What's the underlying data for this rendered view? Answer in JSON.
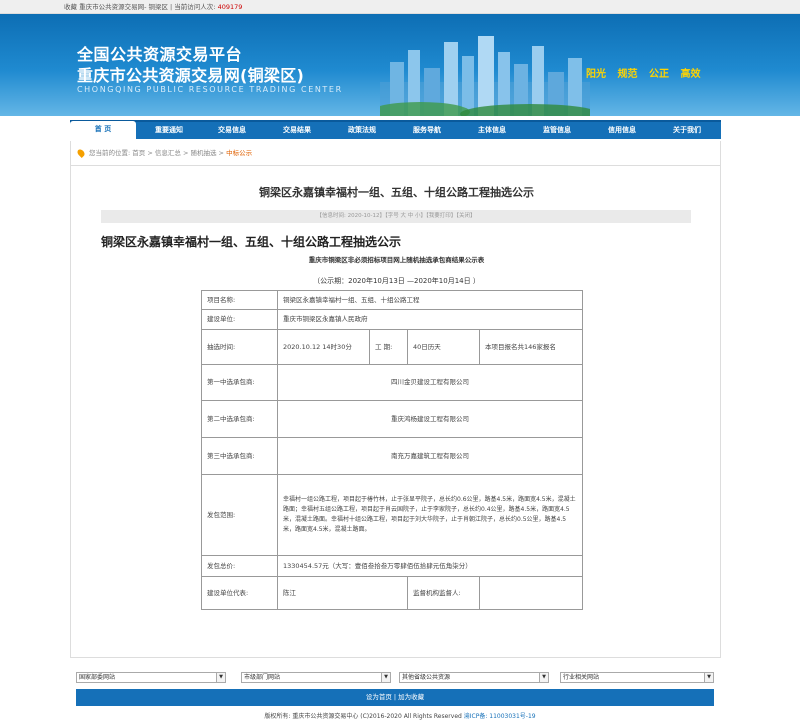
{
  "topbar": {
    "text": "收藏 重庆市公共资源交易网- 铜梁区 | 当前访问人次:",
    "count": "409179"
  },
  "banner": {
    "title1": "全国公共资源交易平台",
    "title2": "重庆市公共资源交易网(铜梁区)",
    "title_en": "CHONGQING PUBLIC RESOURCE TRADING CENTER",
    "slogan": [
      "阳光",
      "规范",
      "公正",
      "高效"
    ]
  },
  "nav": {
    "items": [
      "首 页",
      "重要通知",
      "交易信息",
      "交易结果",
      "政策法规",
      "服务导航",
      "主体信息",
      "监管信息",
      "信用信息",
      "关于我们"
    ]
  },
  "breadcrumb": {
    "prefix": "您当前的位置:",
    "path": [
      "首页",
      "信息汇总",
      "随机抽选"
    ],
    "current": "中标公示"
  },
  "article": {
    "title": "铜梁区永嘉镇幸福村一组、五组、十组公路工程抽选公示",
    "info_bar": "【信息时间: 2020-10-12】【字号 大 中 小】【我要打印】【关闭】",
    "heading": "铜梁区永嘉镇幸福村一组、五组、十组公路工程抽选公示",
    "subheading": "重庆市铜梁区非必须招标项目网上随机抽选承包商结果公示表",
    "period": "（公示期：2020年10月13日 —2020年10月14日 ）"
  },
  "table": {
    "project_name_label": "项目名称:",
    "project_name": "铜梁区永嘉镇幸福村一组、五组、十组公路工程",
    "builder_label": "建设单位:",
    "builder": "重庆市铜梁区永嘉镇人民政府",
    "select_time_label": "抽选时间:",
    "select_time": "2020.10.12 14时30分",
    "period_label": "工 期:",
    "period": "40日历天",
    "note": "本项目报名共146家报名",
    "first_label": "第一中选承包商:",
    "first": "四川金贝建设工程有限公司",
    "second_label": "第二中选承包商:",
    "second": "重庆鸿杨建设工程有限公司",
    "third_label": "第三中选承包商:",
    "third": "南充万嘉建筑工程有限公司",
    "scope_label": "发包范围:",
    "scope": "幸福村一组公路工程，项目起于椿竹林，止于张显平院子，总长约0.6公里，路基4.5米，路面宽4.5米，混凝土路面；幸福村五组公路工程，项目起于肖云国院子，止于李家院子，总长约0.4公里，路基4.5米，路面宽4.5米，混凝土路面。幸福村十组公路工程，项目起于刘大华院子，止于肖朝江院子，总长约0.5公里，路基4.5米，路面宽4.5米，混凝土路面。",
    "price_label": "发包总价:",
    "price": "1330454.57元（大写：壹佰叁拾叁万零肆佰伍拾肆元伍角柒分）",
    "rep_label": "建设单位代表:",
    "rep": "陈江",
    "supervisor_label": "监督机构监督人:",
    "supervisor": ""
  },
  "footer": {
    "selects": [
      "国家部委网站",
      "市级部门网站",
      "其他省级公共资源",
      "行业相关网站"
    ],
    "links": "设为首页 | 加为收藏",
    "copyright": "版权所有: 重庆市公共资源交易中心 (C)2016-2020  All Rights Reserved",
    "icp": "渝ICP备: 11003031号-19"
  },
  "colors": {
    "nav_blue": "#1570b8",
    "slogan_yellow": "#ffd400",
    "current_orange": "#e06000"
  }
}
